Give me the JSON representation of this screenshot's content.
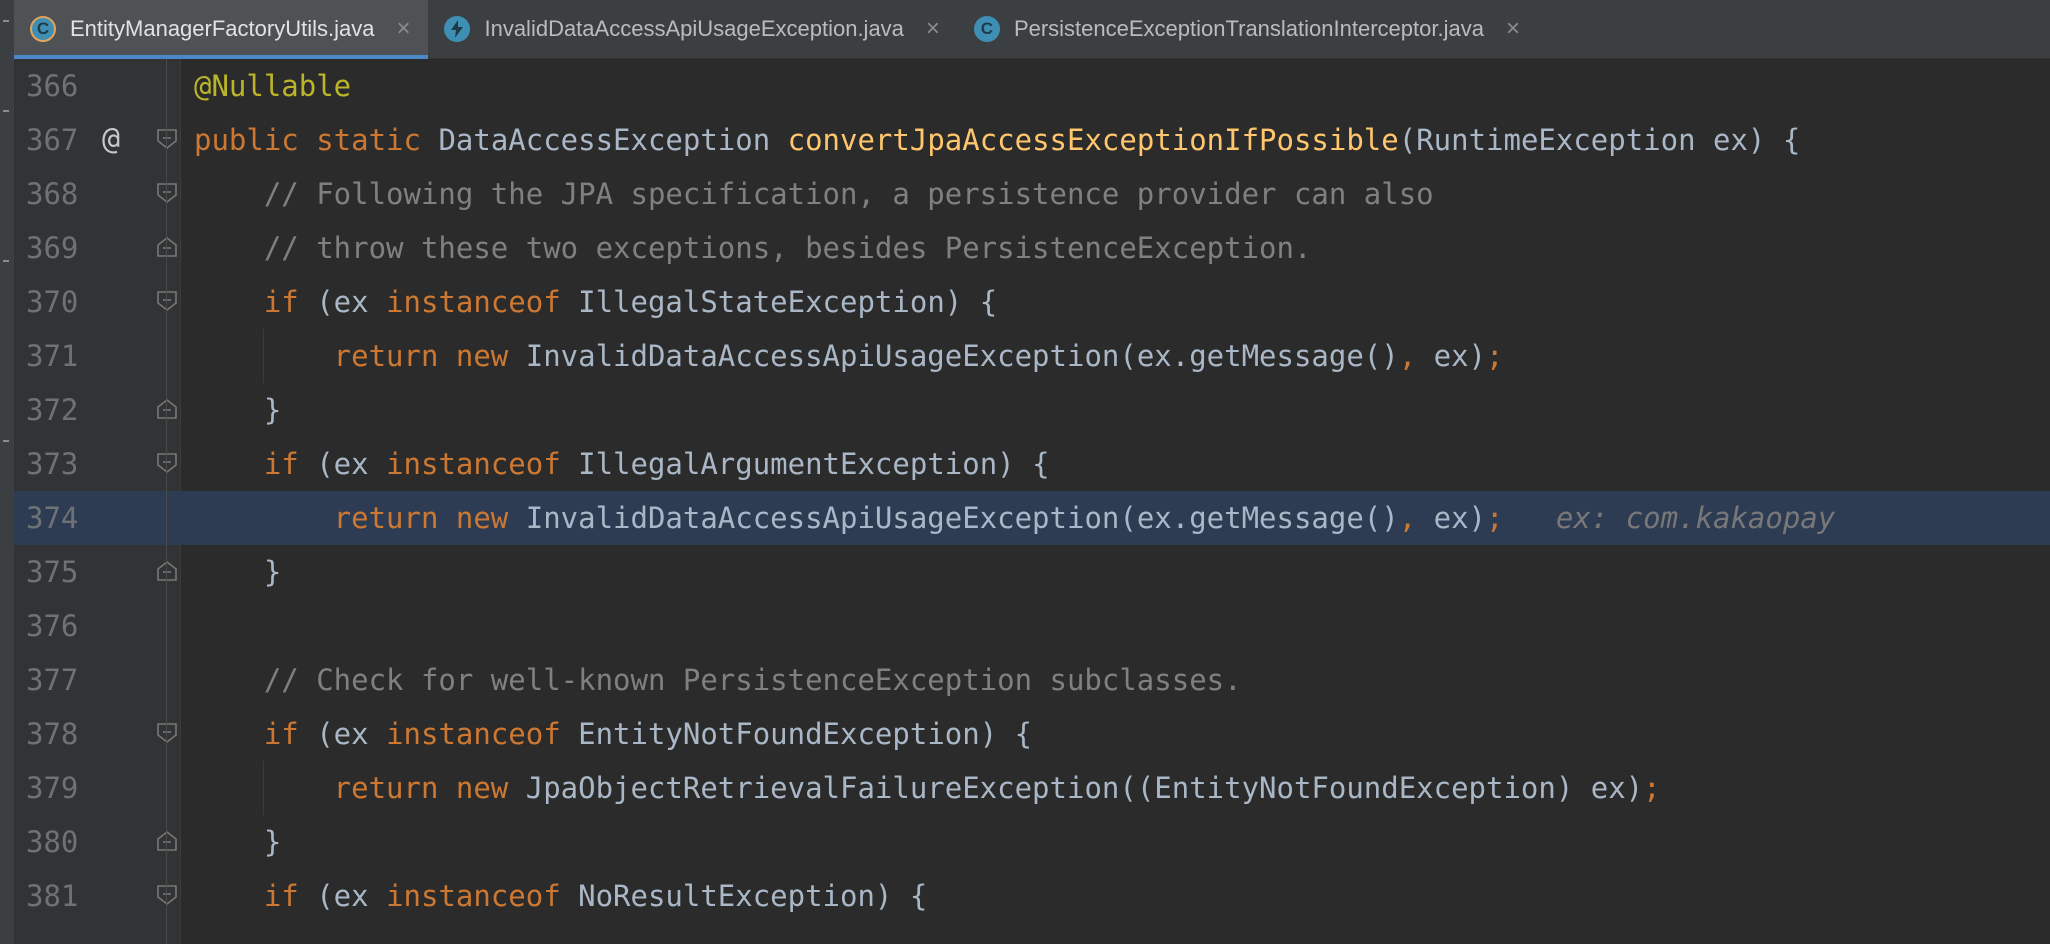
{
  "tabs": [
    {
      "label": "EntityManagerFactoryUtils.java",
      "icon": "class-icon",
      "active": true
    },
    {
      "label": "InvalidDataAccessApiUsageException.java",
      "icon": "exception-class-icon",
      "active": false
    },
    {
      "label": "PersistenceExceptionTranslationInterceptor.java",
      "icon": "class-icon",
      "active": false
    }
  ],
  "lines": [
    {
      "num": "366",
      "parts": [
        {
          "t": "@Nullable",
          "c": "a"
        }
      ]
    },
    {
      "num": "367",
      "marker": "@",
      "parts": [
        {
          "t": "public static ",
          "c": "k"
        },
        {
          "t": "DataAccessException ",
          "c": "t"
        },
        {
          "t": "convertJpaAccessExceptionIfPossible",
          "c": "f"
        },
        {
          "t": "(RuntimeException ex) {",
          "c": "t"
        }
      ]
    },
    {
      "num": "368",
      "parts": [
        {
          "t": "    // Following the JPA specification, a persistence provider can also",
          "c": "c"
        }
      ]
    },
    {
      "num": "369",
      "parts": [
        {
          "t": "    // throw these two exceptions, besides PersistenceException.",
          "c": "c"
        }
      ]
    },
    {
      "num": "370",
      "parts": [
        {
          "t": "    if ",
          "c": "k"
        },
        {
          "t": "(ex ",
          "c": "t"
        },
        {
          "t": "instanceof ",
          "c": "k"
        },
        {
          "t": "IllegalStateException) {",
          "c": "t"
        }
      ]
    },
    {
      "num": "371",
      "parts": [
        {
          "t": "        return new ",
          "c": "k"
        },
        {
          "t": "InvalidDataAccessApiUsageException(ex.getMessage()",
          "c": "t"
        },
        {
          "t": ", ",
          "c": "k"
        },
        {
          "t": "ex)",
          "c": "t"
        },
        {
          "t": ";",
          "c": "k"
        }
      ]
    },
    {
      "num": "372",
      "parts": [
        {
          "t": "    }",
          "c": "t"
        }
      ]
    },
    {
      "num": "373",
      "parts": [
        {
          "t": "    if ",
          "c": "k"
        },
        {
          "t": "(ex ",
          "c": "t"
        },
        {
          "t": "instanceof ",
          "c": "k"
        },
        {
          "t": "IllegalArgumentException) {",
          "c": "t"
        }
      ]
    },
    {
      "num": "374",
      "highlight": true,
      "parts": [
        {
          "t": "        return new ",
          "c": "k"
        },
        {
          "t": "InvalidDataAccessApiUsageException(ex.getMessage()",
          "c": "t"
        },
        {
          "t": ", ",
          "c": "k"
        },
        {
          "t": "ex)",
          "c": "t"
        },
        {
          "t": ";",
          "c": "k"
        },
        {
          "t": "   ex: com.kakaopay",
          "c": "hint"
        }
      ]
    },
    {
      "num": "375",
      "parts": [
        {
          "t": "    }",
          "c": "t"
        }
      ]
    },
    {
      "num": "376",
      "parts": []
    },
    {
      "num": "377",
      "parts": [
        {
          "t": "    // Check for well-known PersistenceException subclasses.",
          "c": "c"
        }
      ]
    },
    {
      "num": "378",
      "parts": [
        {
          "t": "    if ",
          "c": "k"
        },
        {
          "t": "(ex ",
          "c": "t"
        },
        {
          "t": "instanceof ",
          "c": "k"
        },
        {
          "t": "EntityNotFoundException) {",
          "c": "t"
        }
      ]
    },
    {
      "num": "379",
      "parts": [
        {
          "t": "        return new ",
          "c": "k"
        },
        {
          "t": "JpaObjectRetrievalFailureException((EntityNotFoundException) ex)",
          "c": "t"
        },
        {
          "t": ";",
          "c": "k"
        }
      ]
    },
    {
      "num": "380",
      "parts": [
        {
          "t": "    }",
          "c": "t"
        }
      ]
    },
    {
      "num": "381",
      "parts": [
        {
          "t": "    if ",
          "c": "k"
        },
        {
          "t": "(ex ",
          "c": "t"
        },
        {
          "t": "instanceof ",
          "c": "k"
        },
        {
          "t": "NoResultException) {",
          "c": "t"
        }
      ]
    }
  ],
  "folds": {
    "367": "open",
    "368": "open",
    "369": "close",
    "370": "open",
    "372": "close",
    "373": "open",
    "375": "close",
    "378": "open",
    "380": "close",
    "381": "open"
  },
  "colors": {
    "keyword": "#cc7832",
    "annotation": "#bbb529",
    "method": "#ffc66d",
    "comment": "#808080",
    "text": "#a9b7c6",
    "highlight": "#2d3c53",
    "tab_accent": "#4a88c7"
  }
}
